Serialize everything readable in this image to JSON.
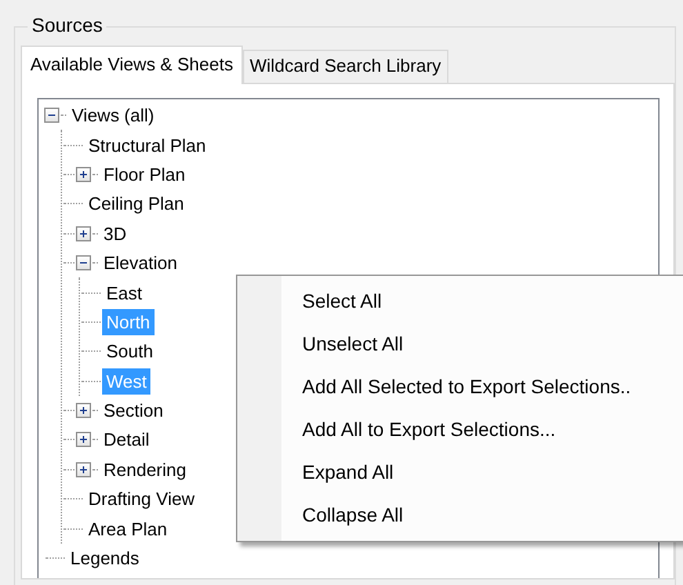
{
  "group": {
    "title": "Sources"
  },
  "tabs": [
    {
      "label": "Available Views & Sheets",
      "selected": true
    },
    {
      "label": "Wildcard Search Library",
      "selected": false
    }
  ],
  "tree": [
    {
      "label": "Views (all)",
      "expanded": true,
      "selected": false,
      "children": [
        {
          "label": "Structural Plan",
          "selected": false
        },
        {
          "label": "Floor Plan",
          "expanded": false,
          "selected": false
        },
        {
          "label": "Ceiling Plan",
          "selected": false
        },
        {
          "label": "3D",
          "expanded": false,
          "selected": false
        },
        {
          "label": "Elevation",
          "expanded": true,
          "selected": false,
          "children": [
            {
              "label": "East",
              "selected": false
            },
            {
              "label": "North",
              "selected": true
            },
            {
              "label": "South",
              "selected": false
            },
            {
              "label": "West",
              "selected": true
            }
          ]
        },
        {
          "label": "Section",
          "expanded": false,
          "selected": false
        },
        {
          "label": "Detail",
          "expanded": false,
          "selected": false
        },
        {
          "label": "Rendering",
          "expanded": false,
          "selected": false
        },
        {
          "label": "Drafting View",
          "selected": false
        },
        {
          "label": "Area Plan",
          "selected": false
        }
      ]
    },
    {
      "label": "Legends",
      "selected": false
    }
  ],
  "context_menu": [
    "Select All",
    "Unselect All",
    "Add All Selected to Export Selections..",
    "Add All to Export Selections...",
    "Expand All",
    "Collapse All"
  ]
}
